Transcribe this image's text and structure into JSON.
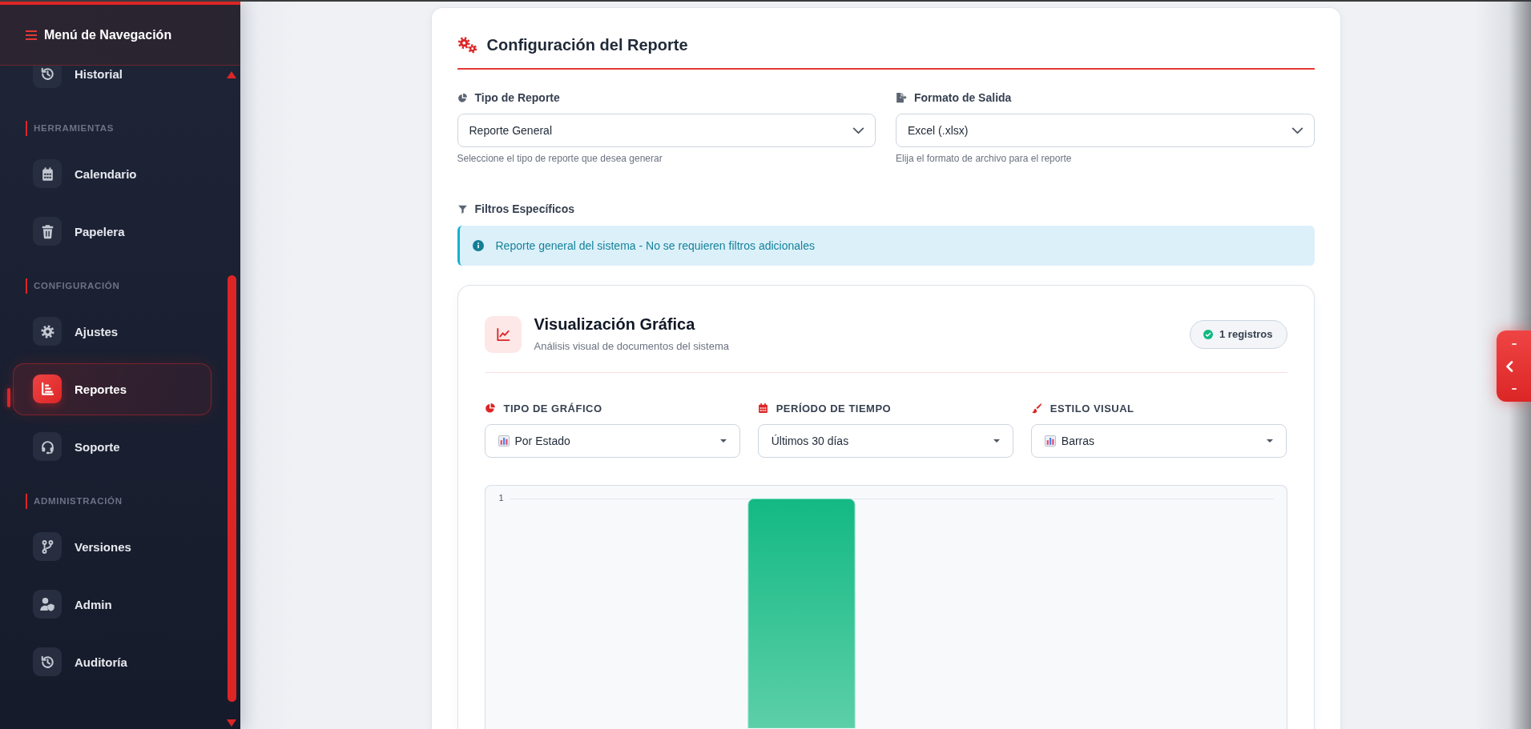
{
  "sidebar": {
    "title": "Menú de Navegación",
    "sections": [
      {
        "items": [
          {
            "label": "Historial",
            "selected": false
          }
        ]
      },
      {
        "label": "HERRAMIENTAS",
        "items": [
          {
            "label": "Calendario",
            "selected": false
          },
          {
            "label": "Papelera",
            "selected": false
          }
        ]
      },
      {
        "label": "CONFIGURACIÓN",
        "items": [
          {
            "label": "Ajustes",
            "selected": false
          },
          {
            "label": "Reportes",
            "selected": true
          },
          {
            "label": "Soporte",
            "selected": false
          }
        ]
      },
      {
        "label": "ADMINISTRACIÓN",
        "items": [
          {
            "label": "Versiones",
            "selected": false
          },
          {
            "label": "Admin",
            "selected": false
          },
          {
            "label": "Auditoría",
            "selected": false
          }
        ]
      }
    ]
  },
  "report_config": {
    "title": "Configuración del Reporte",
    "fields": [
      {
        "label": "Tipo de Reporte",
        "value": "Reporte General",
        "help": "Seleccione el tipo de reporte que desea generar"
      },
      {
        "label": "Formato de Salida",
        "value": "Excel (.xlsx)",
        "help": "Elija el formato de archivo para el reporte"
      }
    ],
    "filters": {
      "label": "Filtros Específicos",
      "message": "Reporte general del sistema - No se requieren filtros adicionales"
    }
  },
  "chart_panel": {
    "title": "Visualización Gráfica",
    "subtitle": "Análisis visual de documentos del sistema",
    "badge": "1 registros",
    "controls": [
      {
        "label": "TIPO DE GRÁFICO",
        "value": "Por Estado",
        "kind": "emoji"
      },
      {
        "label": "PERÍODO DE TIEMPO",
        "value": "Últimos 30 días",
        "kind": "plain"
      },
      {
        "label": "ESTILO VISUAL",
        "value": "Barras",
        "kind": "emoji"
      }
    ],
    "chart": {
      "y_tick": "1"
    }
  }
}
